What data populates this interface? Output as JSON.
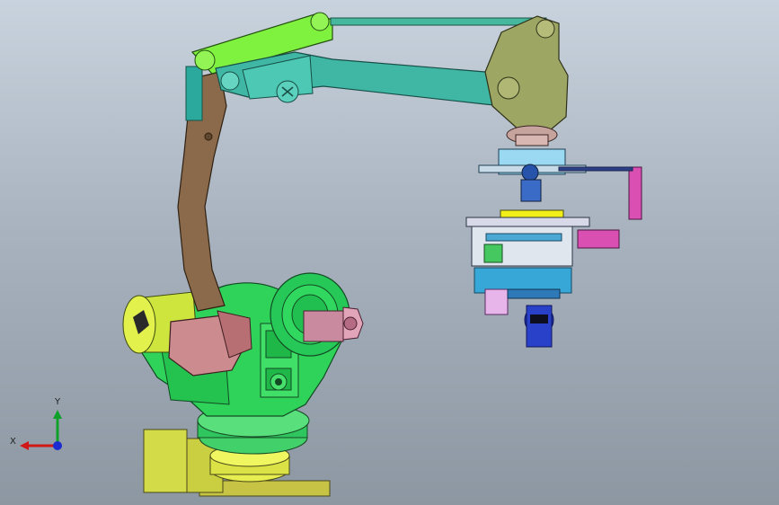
{
  "triad": {
    "x_label": "X",
    "y_label": "Y",
    "x_color": "#d01818",
    "y_color": "#0fa02a",
    "z_color": "#1a2cd0"
  },
  "palette": {
    "background_top": "#c9d3de",
    "background_bottom": "#8c97a2",
    "base_yellow": "#d6dd4a",
    "body_green": "#2fd35a",
    "boom_teal": "#3fb7a4",
    "rear_arm_brown": "#8a6a4a",
    "motor_pink": "#c98aa0",
    "gripper_blue": "#36a7d6",
    "gripper_yellow": "#f2ee18",
    "motor_blue": "#1e2fb0"
  }
}
